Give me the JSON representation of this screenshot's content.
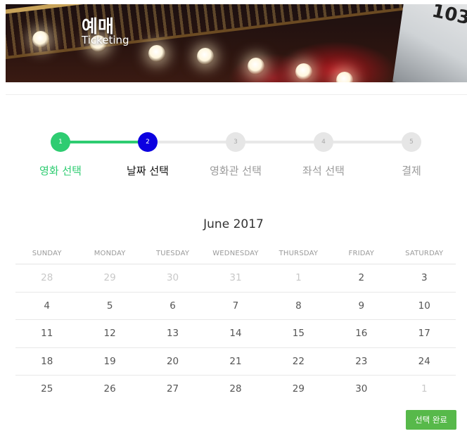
{
  "header": {
    "title": "예매",
    "subtitle": "Ticketing",
    "sign_text": "103"
  },
  "stepper": {
    "steps": [
      {
        "number": "1",
        "label": "영화 선택",
        "state": "done"
      },
      {
        "number": "2",
        "label": "날짜 선택",
        "state": "current"
      },
      {
        "number": "3",
        "label": "영화관 선택",
        "state": "todo"
      },
      {
        "number": "4",
        "label": "좌석 선택",
        "state": "todo"
      },
      {
        "number": "5",
        "label": "결제",
        "state": "todo"
      }
    ]
  },
  "calendar": {
    "month_label": "June 2017",
    "weekdays": [
      "SUNDAY",
      "MONDAY",
      "TUESDAY",
      "WEDNESDAY",
      "THURSDAY",
      "FRIDAY",
      "SATURDAY"
    ],
    "weeks": [
      [
        {
          "d": "28",
          "m": true
        },
        {
          "d": "29",
          "m": true
        },
        {
          "d": "30",
          "m": true
        },
        {
          "d": "31",
          "m": true
        },
        {
          "d": "1",
          "m": true
        },
        {
          "d": "2",
          "m": false
        },
        {
          "d": "3",
          "m": false
        }
      ],
      [
        {
          "d": "4",
          "m": false
        },
        {
          "d": "5",
          "m": false
        },
        {
          "d": "6",
          "m": false
        },
        {
          "d": "7",
          "m": false
        },
        {
          "d": "8",
          "m": false
        },
        {
          "d": "9",
          "m": false
        },
        {
          "d": "10",
          "m": false
        }
      ],
      [
        {
          "d": "11",
          "m": false
        },
        {
          "d": "12",
          "m": false
        },
        {
          "d": "13",
          "m": false
        },
        {
          "d": "14",
          "m": false
        },
        {
          "d": "15",
          "m": false
        },
        {
          "d": "16",
          "m": false
        },
        {
          "d": "17",
          "m": false
        }
      ],
      [
        {
          "d": "18",
          "m": false
        },
        {
          "d": "19",
          "m": false
        },
        {
          "d": "20",
          "m": false
        },
        {
          "d": "21",
          "m": false
        },
        {
          "d": "22",
          "m": false
        },
        {
          "d": "23",
          "m": false
        },
        {
          "d": "24",
          "m": false
        }
      ],
      [
        {
          "d": "25",
          "m": false
        },
        {
          "d": "26",
          "m": false
        },
        {
          "d": "27",
          "m": false
        },
        {
          "d": "28",
          "m": false
        },
        {
          "d": "29",
          "m": false
        },
        {
          "d": "30",
          "m": false
        },
        {
          "d": "1",
          "m": true
        }
      ]
    ]
  },
  "actions": {
    "done_label": "선택 완료"
  },
  "colors": {
    "done": "#2ecc71",
    "current": "#0c00e0",
    "pending": "#e6e6e6",
    "button": "#57b94a"
  }
}
